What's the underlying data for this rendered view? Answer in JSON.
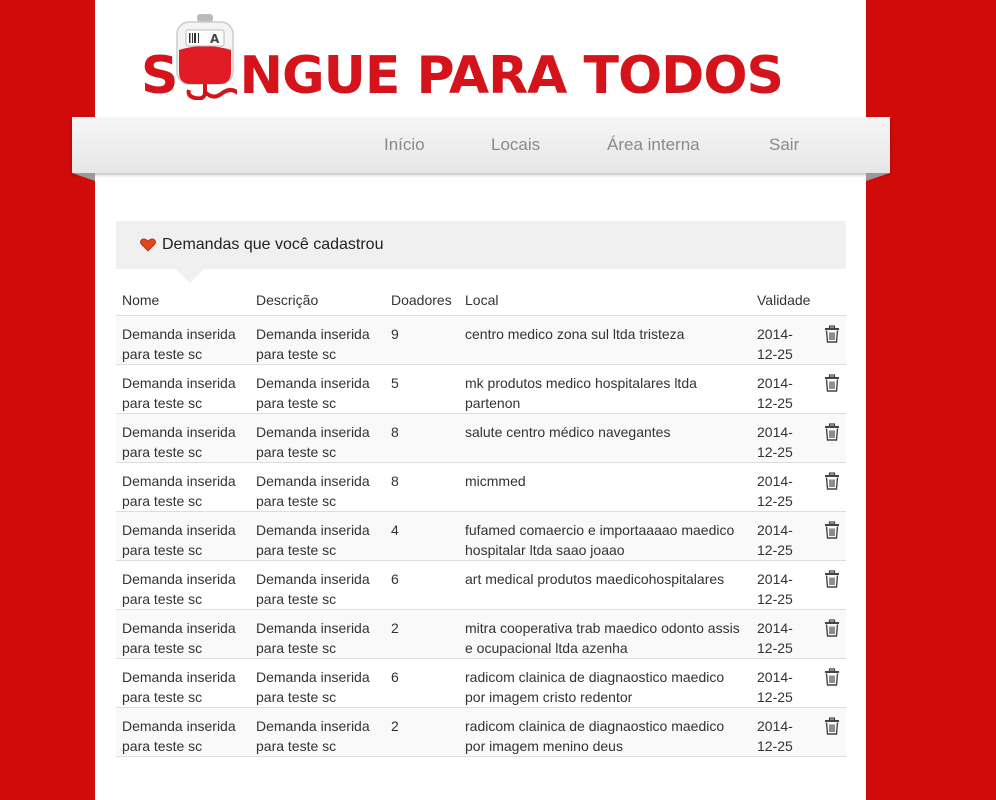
{
  "brand": {
    "title_part1": "S",
    "title_part2": "NGUE PARA TODOS",
    "bag_label": "A"
  },
  "nav": {
    "items": [
      {
        "label": "Início"
      },
      {
        "label": "Locais"
      },
      {
        "label": "Área interna"
      },
      {
        "label": "Sair"
      }
    ]
  },
  "panel": {
    "title": "Demandas que você cadastrou",
    "icon": "heart-icon"
  },
  "table": {
    "headers": {
      "nome": "Nome",
      "descricao": "Descrição",
      "doadores": "Doadores",
      "local": "Local",
      "validade": "Validade"
    },
    "rows": [
      {
        "nome": "Demanda inserida para teste sc",
        "descricao": "Demanda inserida para teste sc",
        "doadores": "9",
        "local": "centro medico zona sul ltda tristeza",
        "validade": "2014-12-25"
      },
      {
        "nome": "Demanda inserida para teste sc",
        "descricao": "Demanda inserida para teste sc",
        "doadores": "5",
        "local": "mk produtos medico hospitalares ltda partenon",
        "validade": "2014-12-25"
      },
      {
        "nome": "Demanda inserida para teste sc",
        "descricao": "Demanda inserida para teste sc",
        "doadores": "8",
        "local": "salute centro médico navegantes",
        "validade": "2014-12-25"
      },
      {
        "nome": "Demanda inserida para teste sc",
        "descricao": "Demanda inserida para teste sc",
        "doadores": "8",
        "local": "micmmed",
        "validade": "2014-12-25"
      },
      {
        "nome": "Demanda inserida para teste sc",
        "descricao": "Demanda inserida para teste sc",
        "doadores": "4",
        "local": "fufamed comaercio e importaaaao maedico hospitalar ltda saao joaao",
        "validade": "2014-12-25"
      },
      {
        "nome": "Demanda inserida para teste sc",
        "descricao": "Demanda inserida para teste sc",
        "doadores": "6",
        "local": "art medical produtos maedicohospitalares",
        "validade": "2014-12-25"
      },
      {
        "nome": "Demanda inserida para teste sc",
        "descricao": "Demanda inserida para teste sc",
        "doadores": "2",
        "local": "mitra cooperativa trab maedico odonto assis e ocupacional ltda azenha",
        "validade": "2014-12-25"
      },
      {
        "nome": "Demanda inserida para teste sc",
        "descricao": "Demanda inserida para teste sc",
        "doadores": "6",
        "local": "radicom clainica de diagnaostico maedico por imagem cristo redentor",
        "validade": "2014-12-25"
      },
      {
        "nome": "Demanda inserida para teste sc",
        "descricao": "Demanda inserida para teste sc",
        "doadores": "2",
        "local": "radicom clainica de diagnaostico maedico por imagem menino deus",
        "validade": "2014-12-25"
      }
    ],
    "row_action_icon": "trash-icon"
  },
  "colors": {
    "background": "#d10a0a",
    "brand_red": "#d4131b",
    "nav_text": "#8a8a8a"
  }
}
